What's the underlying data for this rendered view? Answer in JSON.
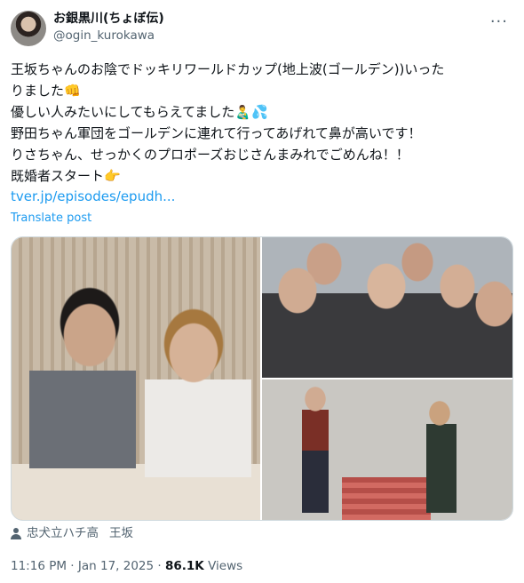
{
  "author": {
    "display_name": "お銀黒川(ちょぼ伝)",
    "handle": "@ogin_kurokawa"
  },
  "more_icon": "more-dots-icon",
  "tweet": {
    "text": "王坂ちゃんのお陰でドッキリワールドカップ(地上波(ゴールデン))いった\nりました👊\n優しい人みたいにしてもらえてました👨‍🍼💦\n野田ちゃん軍団をゴールデンに連れて行ってあげれて鼻が高いです！\nりさちゃん、せっかくのプロポーズおじさんまみれでごめんね！！\n既婚者スタート👉",
    "link": "tver.jp/episodes/epudh...",
    "translate": "Translate post"
  },
  "location": {
    "icon": "person-icon",
    "place": "忠犬立ハチ高",
    "person": "王坂"
  },
  "meta": {
    "time": "11:16 PM",
    "dot": "·",
    "date": "Jan 17, 2025",
    "views_count": "86.1K",
    "views_label": "Views"
  },
  "colors": {
    "link": "#1d9bf0",
    "secondary_text": "#536471",
    "primary_text": "#0f1419"
  }
}
